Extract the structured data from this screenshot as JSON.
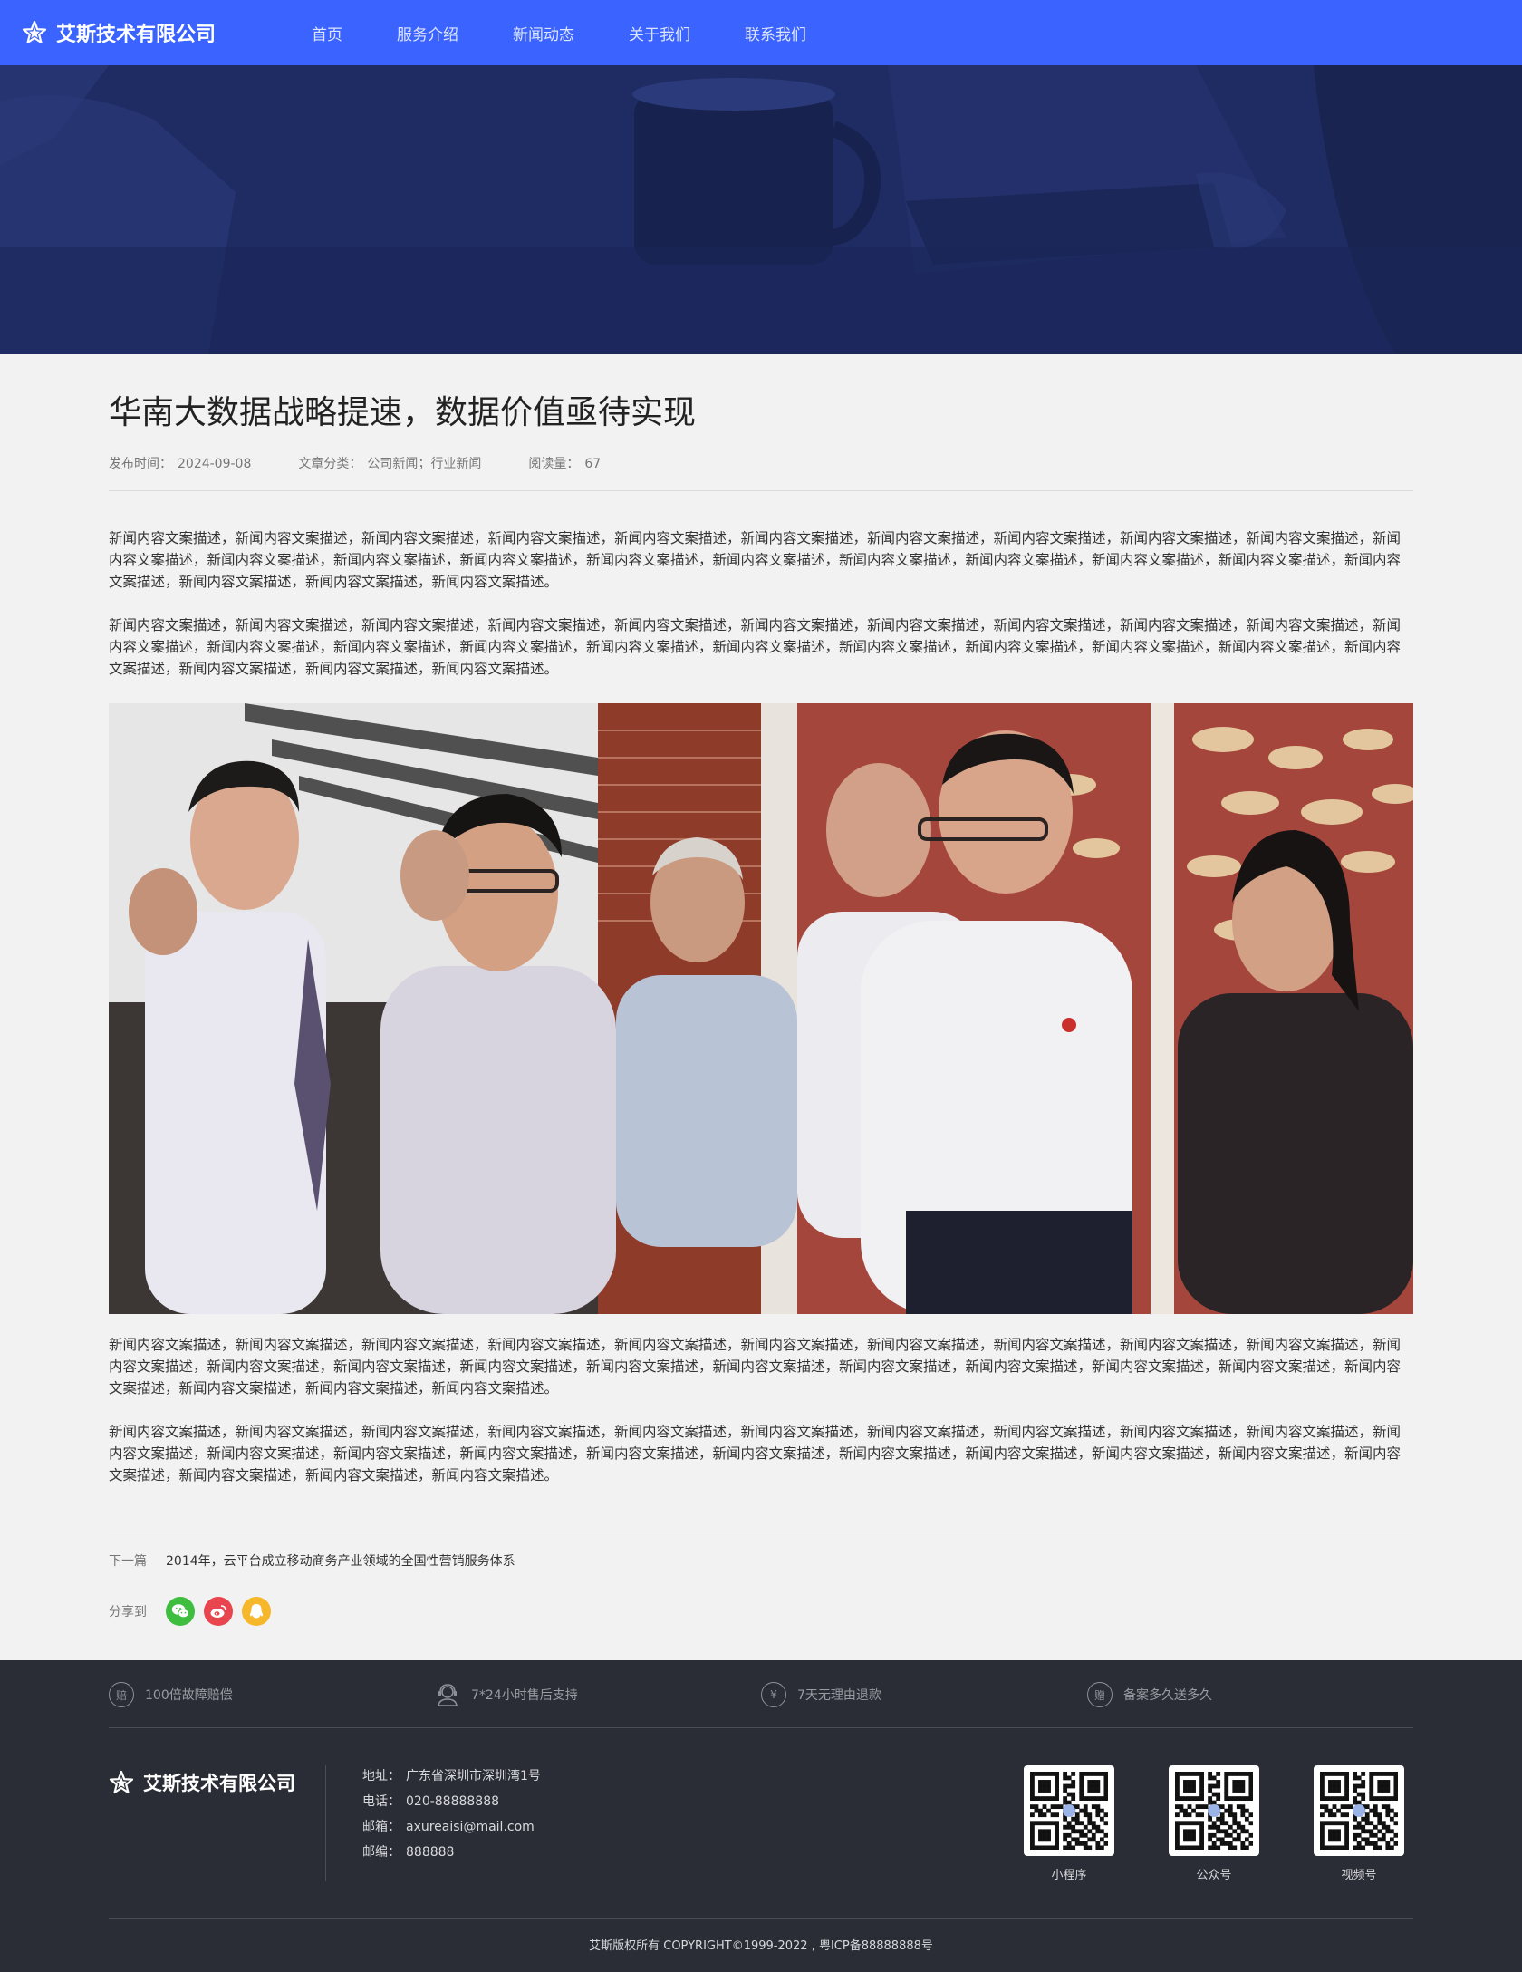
{
  "header": {
    "company": "艾斯技术有限公司",
    "nav": [
      "首页",
      "服务介绍",
      "新闻动态",
      "关于我们",
      "联系我们"
    ]
  },
  "article": {
    "title": "华南大数据战略提速，数据价值亟待实现",
    "meta": {
      "date_label": "发布时间：",
      "date": "2024-09-08",
      "category_label": "文章分类：",
      "category": "公司新闻；行业新闻",
      "views_label": "阅读量：",
      "views": "67"
    },
    "paragraphs": [
      "新闻内容文案描述，新闻内容文案描述，新闻内容文案描述，新闻内容文案描述，新闻内容文案描述，新闻内容文案描述，新闻内容文案描述，新闻内容文案描述，新闻内容文案描述，新闻内容文案描述，新闻内容文案描述，新闻内容文案描述，新闻内容文案描述，新闻内容文案描述，新闻内容文案描述，新闻内容文案描述，新闻内容文案描述，新闻内容文案描述，新闻内容文案描述，新闻内容文案描述，新闻内容文案描述，新闻内容文案描述，新闻内容文案描述，新闻内容文案描述。",
      "新闻内容文案描述，新闻内容文案描述，新闻内容文案描述，新闻内容文案描述，新闻内容文案描述，新闻内容文案描述，新闻内容文案描述，新闻内容文案描述，新闻内容文案描述，新闻内容文案描述，新闻内容文案描述，新闻内容文案描述，新闻内容文案描述，新闻内容文案描述，新闻内容文案描述，新闻内容文案描述，新闻内容文案描述，新闻内容文案描述，新闻内容文案描述，新闻内容文案描述，新闻内容文案描述，新闻内容文案描述，新闻内容文案描述，新闻内容文案描述。",
      "新闻内容文案描述，新闻内容文案描述，新闻内容文案描述，新闻内容文案描述，新闻内容文案描述，新闻内容文案描述，新闻内容文案描述，新闻内容文案描述，新闻内容文案描述，新闻内容文案描述，新闻内容文案描述，新闻内容文案描述，新闻内容文案描述，新闻内容文案描述，新闻内容文案描述，新闻内容文案描述，新闻内容文案描述，新闻内容文案描述，新闻内容文案描述，新闻内容文案描述，新闻内容文案描述，新闻内容文案描述，新闻内容文案描述，新闻内容文案描述。",
      "新闻内容文案描述，新闻内容文案描述，新闻内容文案描述，新闻内容文案描述，新闻内容文案描述，新闻内容文案描述，新闻内容文案描述，新闻内容文案描述，新闻内容文案描述，新闻内容文案描述，新闻内容文案描述，新闻内容文案描述，新闻内容文案描述，新闻内容文案描述，新闻内容文案描述，新闻内容文案描述，新闻内容文案描述，新闻内容文案描述，新闻内容文案描述，新闻内容文案描述，新闻内容文案描述，新闻内容文案描述，新闻内容文案描述，新闻内容文案描述。"
    ],
    "next": {
      "label": "下一篇",
      "title": "2014年，云平台成立移动商务产业领域的全国性营销服务体系"
    },
    "share": {
      "label": "分享到",
      "icons": [
        "wechat-icon",
        "weibo-icon",
        "qq-icon"
      ]
    }
  },
  "footer": {
    "features": [
      {
        "icon": "compensation-icon",
        "glyph": "赔",
        "text": "100倍故障赔偿"
      },
      {
        "icon": "customer-service-icon",
        "glyph": "",
        "text": "7*24小时售后支持"
      },
      {
        "icon": "refund-icon",
        "glyph": "¥",
        "text": "7天无理由退款"
      },
      {
        "icon": "gift-icon",
        "glyph": "赠",
        "text": "备案多久送多久"
      }
    ],
    "company": "艾斯技术有限公司",
    "contact": {
      "address_label": "地址：",
      "address": "广东省深圳市深圳湾1号",
      "phone_label": "电话：",
      "phone": "020-88888888",
      "email_label": "邮箱：",
      "email": "axureaisi@mail.com",
      "postcode_label": "邮编：",
      "postcode": "888888"
    },
    "qrcodes": [
      "小程序",
      "公众号",
      "视频号"
    ],
    "copyright": "艾斯版权所有 COPYRIGHT©1999-2022 , 粤ICP备88888888号"
  },
  "colors": {
    "nav_bg": "#3a63ff",
    "hero_bg": "#1f2c63",
    "page_bg": "#f2f2f2",
    "footer_bg": "#2a2d35",
    "wechat": "#3ebd3e",
    "weibo": "#e8454e",
    "qq": "#f7b72b"
  }
}
